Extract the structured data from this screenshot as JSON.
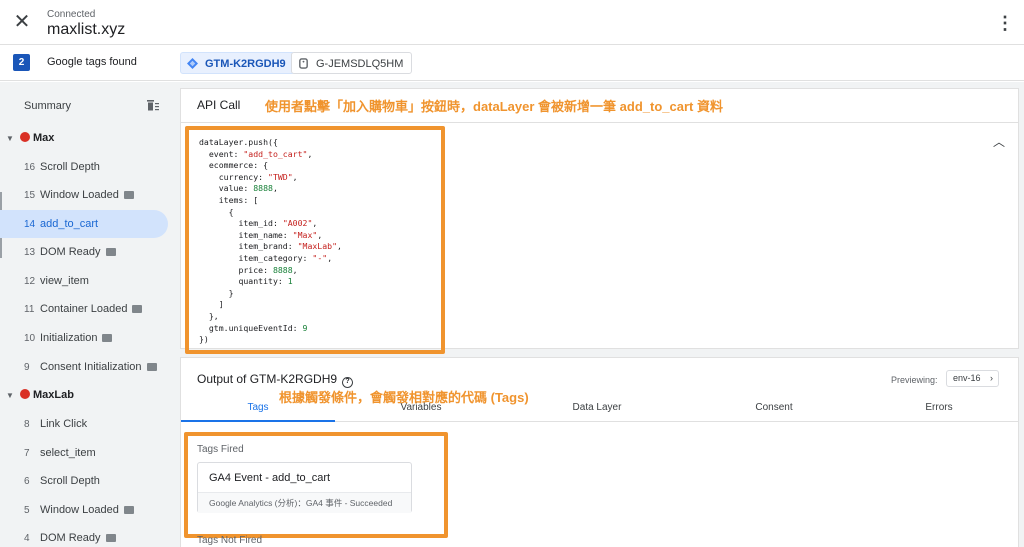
{
  "header": {
    "status": "Connected",
    "site": "maxlist.xyz",
    "close_icon": "close-icon",
    "menu_icon": "more-vert-icon"
  },
  "tagbar": {
    "count": "2",
    "found_label": "Google tags found",
    "chips": [
      {
        "label": "GTM-K2RGDH9",
        "icon": "gtm-diamond-icon",
        "active": true
      },
      {
        "label": "G-JEMSDLQ5HM",
        "icon": "ga-tag-icon",
        "active": false
      }
    ]
  },
  "sidebar": {
    "summary": "Summary",
    "sections": [
      {
        "label": "Max",
        "events": [
          {
            "num": "16",
            "name": "Scroll Depth",
            "badge": false
          },
          {
            "num": "15",
            "name": "Window Loaded",
            "badge": true
          },
          {
            "num": "14",
            "name": "add_to_cart",
            "badge": false,
            "active": true
          },
          {
            "num": "13",
            "name": "DOM Ready",
            "badge": true
          },
          {
            "num": "12",
            "name": "view_item",
            "badge": false
          },
          {
            "num": "11",
            "name": "Container Loaded",
            "badge": true
          },
          {
            "num": "10",
            "name": "Initialization",
            "badge": true
          },
          {
            "num": "9",
            "name": "Consent Initialization",
            "badge": true
          }
        ]
      },
      {
        "label": "MaxLab",
        "events": [
          {
            "num": "8",
            "name": "Link Click",
            "badge": false
          },
          {
            "num": "7",
            "name": "select_item",
            "badge": false
          },
          {
            "num": "6",
            "name": "Scroll Depth",
            "badge": false
          },
          {
            "num": "5",
            "name": "Window Loaded",
            "badge": true
          },
          {
            "num": "4",
            "name": "DOM Ready",
            "badge": true
          }
        ]
      }
    ]
  },
  "api_card": {
    "title": "API Call",
    "annotation": "使用者點擊「加入購物車」按鈕時，dataLayer 會被新增一筆 add_to_cart 資料",
    "code": {
      "push": "dataLayer.push({",
      "event_key": "event: ",
      "event_val": "\"add_to_cart\"",
      "ecommerce": "ecommerce: {",
      "currency_key": "currency: ",
      "currency_val": "\"TWD\"",
      "value_key": "value: ",
      "value_val": "8888",
      "items": "items: [",
      "open_brace": "{",
      "item_id_key": "item_id: ",
      "item_id_val": "\"A002\"",
      "item_name_key": "item_name: ",
      "item_name_val": "\"Max\"",
      "item_brand_key": "item_brand: ",
      "item_brand_val": "\"MaxLab\"",
      "item_category_key": "item_category: ",
      "item_category_val": "\"-\"",
      "price_key": "price: ",
      "price_val": "8888",
      "quantity_key": "quantity: ",
      "quantity_val": "1",
      "close_brace": "}",
      "close_bracket": "]",
      "close_eco": "},",
      "uid_key": "gtm.uniqueEventId: ",
      "uid_val": "9",
      "end": "})"
    }
  },
  "output_card": {
    "title": "Output of GTM-K2RGDH9",
    "annotation": "根據觸發條件，會觸發相對應的代碼 (Tags)",
    "previewing_label": "Previewing:",
    "env": "env-16",
    "tabs": [
      "Tags",
      "Variables",
      "Data Layer",
      "Consent",
      "Errors"
    ],
    "tags_fired_label": "Tags Fired",
    "tag": {
      "name": "GA4 Event - add_to_cart",
      "sub": "Google Analytics (分析)：GA4 事件 - Succeeded"
    },
    "tags_not_fired_label": "Tags Not Fired"
  },
  "colors": {
    "accent": "#1a73e8",
    "annotation": "#f0942e",
    "section_dot": "#d93025"
  }
}
